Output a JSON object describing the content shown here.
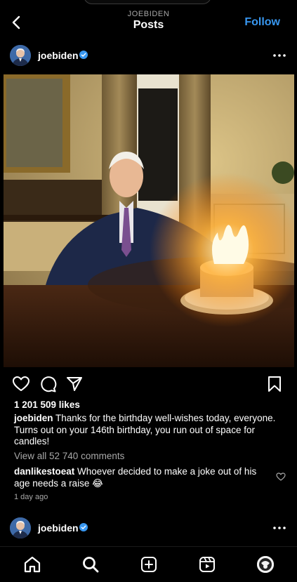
{
  "header": {
    "subtitle": "JOEBIDEN",
    "title": "Posts",
    "follow_label": "Follow"
  },
  "post": {
    "username": "joebiden",
    "likes": "1 201 509 likes",
    "caption_user": "joebiden",
    "caption_text": "Thanks for the birthday well-wishes today, everyone. Turns out on your 146th birthday, you run out of space for candles!",
    "view_all": "View all 52 740 comments",
    "comment": {
      "user": "danlikestoeat",
      "text": "Whoever decided to make a joke out of his age needs a raise 😂"
    },
    "time": "1 day ago"
  },
  "next_post": {
    "username": "joebiden"
  },
  "colors": {
    "accent": "#3897f0",
    "verified": "#3897f0",
    "secondary_text": "#a8a8a8"
  },
  "icons": {
    "header": [
      "back-arrow-icon",
      "more-options-icon"
    ],
    "actions": [
      "heart-icon",
      "comment-icon",
      "share-icon",
      "bookmark-icon"
    ],
    "nav": [
      "home-icon",
      "search-icon",
      "create-icon",
      "reels-icon",
      "profile-avatar"
    ]
  }
}
